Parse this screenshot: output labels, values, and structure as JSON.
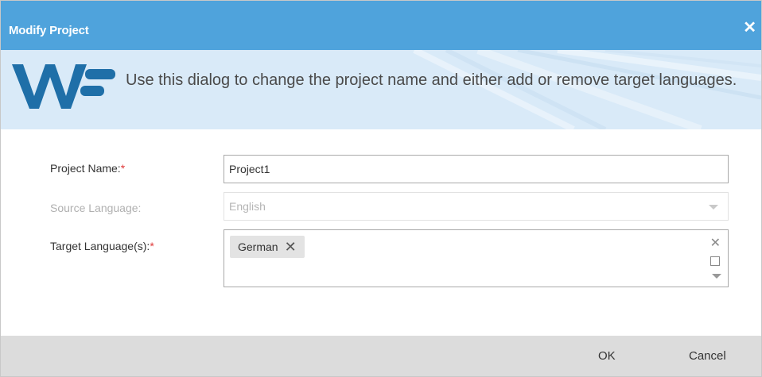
{
  "dialog": {
    "title": "Modify Project",
    "close_icon": "close-icon"
  },
  "banner": {
    "logo_icon": "wf-logo",
    "text": "Use this dialog to change the project name and either add or remove target languages."
  },
  "form": {
    "project_name": {
      "label": "Project Name:",
      "required": "*",
      "value": "Project1"
    },
    "source_language": {
      "label": "Source Language:",
      "value": "English",
      "disabled": true
    },
    "target_languages": {
      "label": "Target Language(s):",
      "required": "*",
      "tags": [
        {
          "label": "German",
          "remove_icon": "remove-tag-icon"
        }
      ],
      "clear_symbol": "✕",
      "icons": [
        "clear-icon",
        "checkbox-icon",
        "chevron-down-icon"
      ]
    }
  },
  "footer": {
    "ok_label": "OK",
    "cancel_label": "Cancel"
  },
  "colors": {
    "titlebar": "#4fa3dc",
    "banner": "#d9eaf8",
    "logo": "#1f6fa8",
    "required": "#e03a3a",
    "footer": "#dcdcdc"
  }
}
